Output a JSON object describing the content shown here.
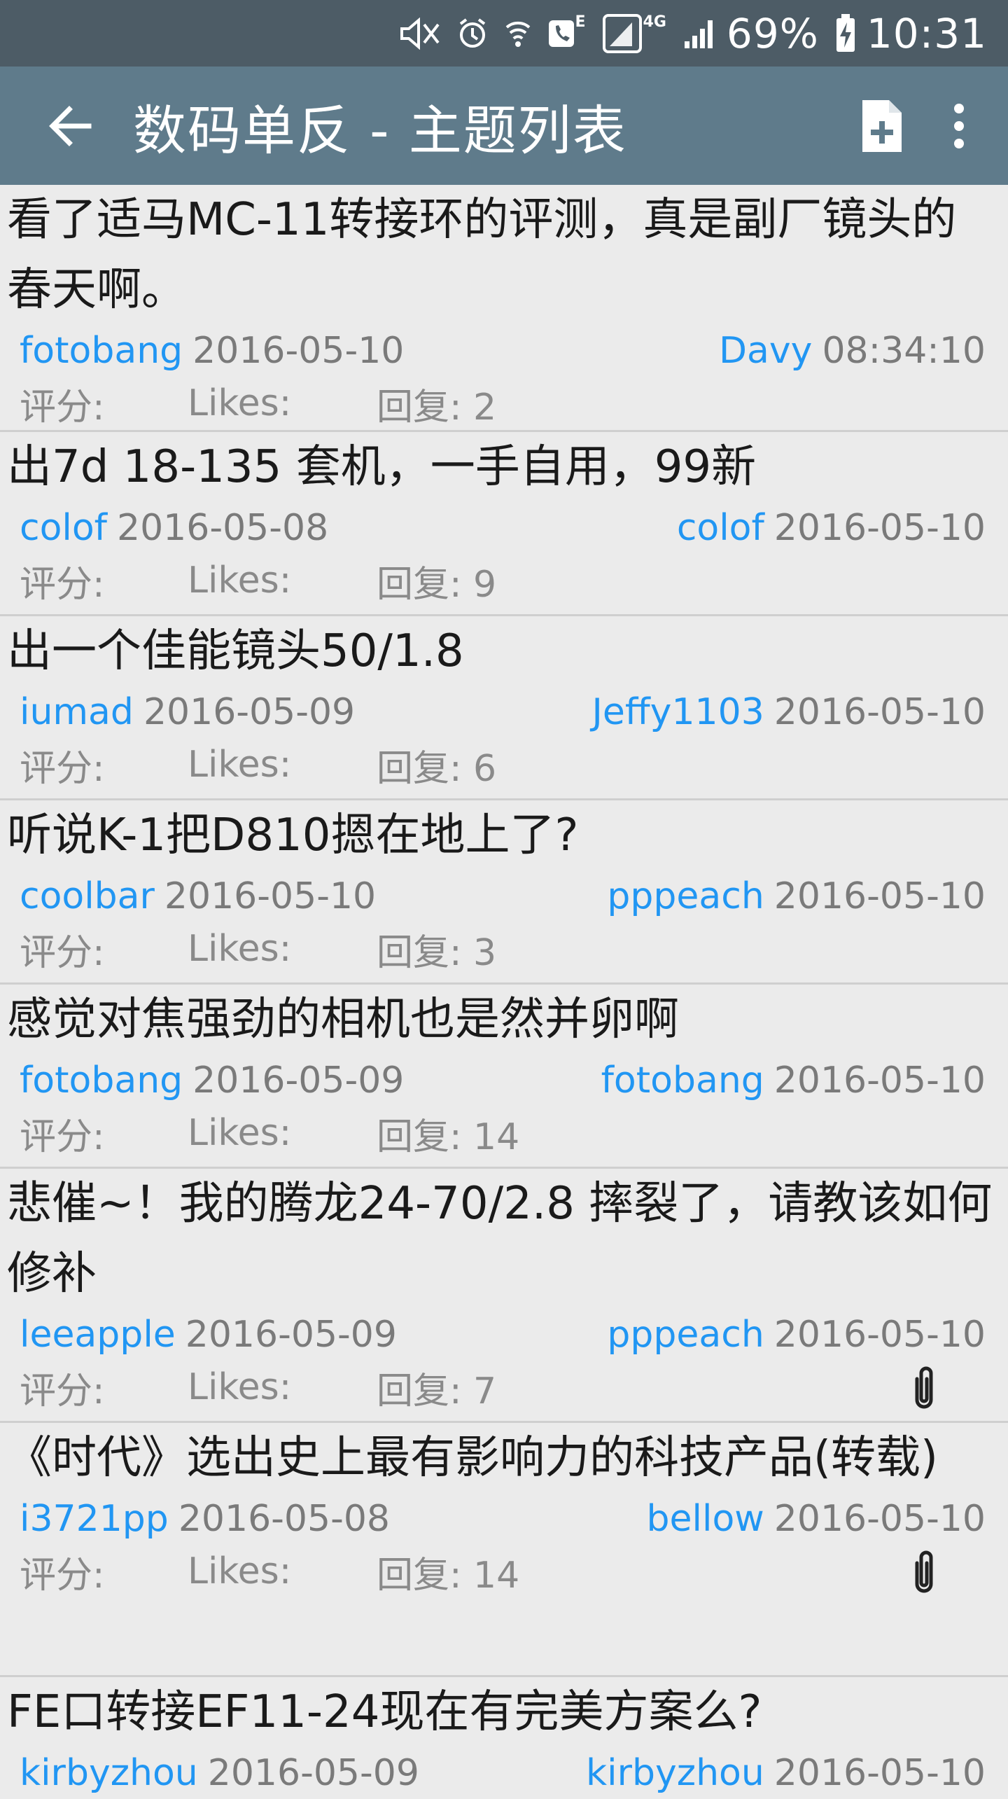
{
  "status_bar": {
    "battery": "69%",
    "time": "10:31",
    "network_e": "E",
    "network_4g": "4G"
  },
  "app_bar": {
    "title": "数码单反 - 主题列表"
  },
  "labels": {
    "score": "评分:",
    "likes": "Likes:",
    "replies_prefix": "回复: "
  },
  "topics": [
    {
      "title": "看了适马MC-11转接环的评测，真是副厂镜头的春天啊。",
      "author": "fotobang",
      "created": "2016-05-10",
      "last_user": "Davy",
      "last_time": "08:34:10",
      "replies": "回复: 2",
      "attachment": false
    },
    {
      "title": "出7d 18-135 套机，一手自用，99新",
      "author": "colof",
      "created": "2016-05-08",
      "last_user": "colof",
      "last_time": "2016-05-10",
      "replies": "回复: 9",
      "attachment": false
    },
    {
      "title": "出一个佳能镜头50/1.8",
      "author": "iumad",
      "created": "2016-05-09",
      "last_user": "Jeffy1103",
      "last_time": "2016-05-10",
      "replies": "回复: 6",
      "attachment": false
    },
    {
      "title": "听说K-1把D810摁在地上了?",
      "author": "coolbar",
      "created": "2016-05-10",
      "last_user": "pppeach",
      "last_time": "2016-05-10",
      "replies": "回复: 3",
      "attachment": false
    },
    {
      "title": "感觉对焦强劲的相机也是然并卵啊",
      "author": "fotobang",
      "created": "2016-05-09",
      "last_user": "fotobang",
      "last_time": "2016-05-10",
      "replies": "回复: 14",
      "attachment": false
    },
    {
      "title": "悲催~！我的腾龙24-70/2.8 摔裂了，请教该如何修补",
      "author": "leeapple",
      "created": "2016-05-09",
      "last_user": "pppeach",
      "last_time": "2016-05-10",
      "replies": "回复: 7",
      "attachment": true
    },
    {
      "title": "《时代》选出史上最有影响力的科技产品(转载)",
      "author": "i3721pp",
      "created": "2016-05-08",
      "last_user": "bellow",
      "last_time": "2016-05-10",
      "replies": "回复: 14",
      "attachment": true
    },
    {
      "title": "FE口转接EF11-24现在有完美方案么?",
      "author": "kirbyzhou",
      "created": "2016-05-09",
      "last_user": "kirbyzhou",
      "last_time": "2016-05-10",
      "replies": "",
      "attachment": false
    }
  ]
}
